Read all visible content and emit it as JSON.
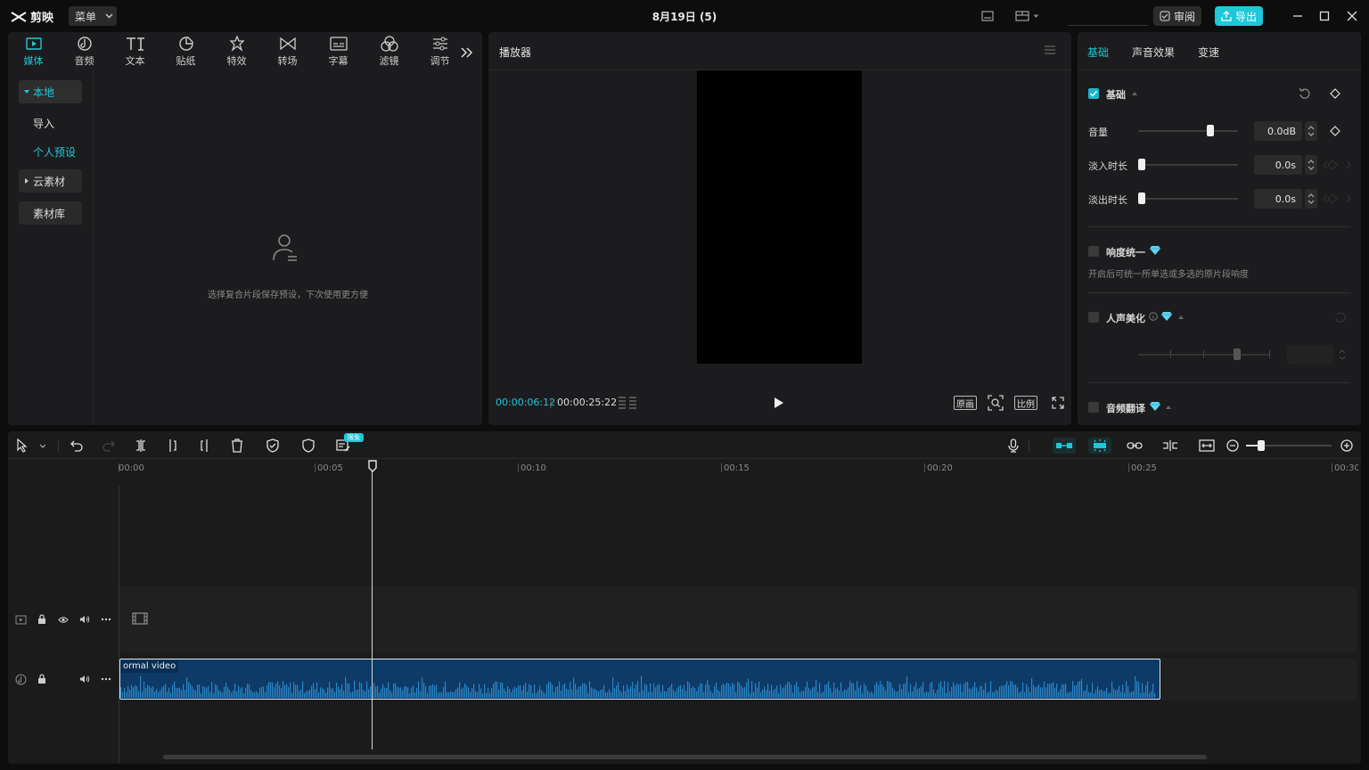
{
  "app": {
    "name": "剪映",
    "menu_label": "菜单",
    "doc_title": "8月19日 (5)"
  },
  "titlebar": {
    "review_label": "审阅",
    "export_label": "导出"
  },
  "media_panel": {
    "tabs": [
      {
        "label": "媒体",
        "icon": "media-icon"
      },
      {
        "label": "音频",
        "icon": "audio-icon"
      },
      {
        "label": "文本",
        "icon": "text-icon"
      },
      {
        "label": "贴纸",
        "icon": "sticker-icon"
      },
      {
        "label": "特效",
        "icon": "effects-icon"
      },
      {
        "label": "转场",
        "icon": "transition-icon"
      },
      {
        "label": "字幕",
        "icon": "subtitle-icon"
      },
      {
        "label": "滤镜",
        "icon": "filter-icon"
      },
      {
        "label": "调节",
        "icon": "adjust-icon"
      }
    ],
    "sidebar": {
      "local": "本地",
      "import": "导入",
      "presets": "个人预设",
      "cloud": "云素材",
      "library": "素材库"
    },
    "empty_text": "选择复合片段保存预设，下次使用更方便"
  },
  "player": {
    "title": "播放器",
    "current_time": "00:00:06:12",
    "total_time": "00:00:25:22",
    "original_label": "原画",
    "ratio_label": "比例"
  },
  "inspector": {
    "tabs": [
      "基础",
      "声音效果",
      "变速"
    ],
    "basic_section": "基础",
    "volume_label": "音量",
    "volume_value": "0.0dB",
    "fadein_label": "淡入时长",
    "fadein_value": "0.0s",
    "fadeout_label": "淡出时长",
    "fadeout_value": "0.0s",
    "loudness_label": "响度统一",
    "loudness_desc": "开启后可统一所单选或多选的原片段响度",
    "voice_label": "人声美化",
    "translate_label": "音频翻译"
  },
  "timeline": {
    "free_badge": "限免",
    "ruler": [
      "00:00",
      "00:05",
      "00:10",
      "00:15",
      "00:20",
      "00:25",
      "00:30"
    ],
    "clip_label": "ormal video"
  },
  "colors": {
    "accent": "#1fc8d8",
    "clip_bg": "#0d3a66",
    "wave": "#2a86c4"
  }
}
